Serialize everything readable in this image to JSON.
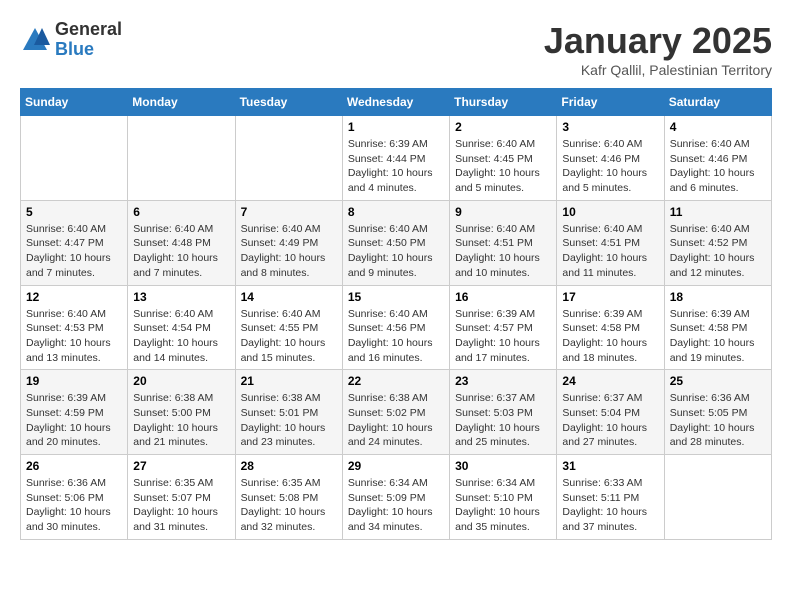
{
  "header": {
    "logo_general": "General",
    "logo_blue": "Blue",
    "month_title": "January 2025",
    "location": "Kafr Qallil, Palestinian Territory"
  },
  "days_of_week": [
    "Sunday",
    "Monday",
    "Tuesday",
    "Wednesday",
    "Thursday",
    "Friday",
    "Saturday"
  ],
  "weeks": [
    [
      {
        "day": "",
        "info": ""
      },
      {
        "day": "",
        "info": ""
      },
      {
        "day": "",
        "info": ""
      },
      {
        "day": "1",
        "info": "Sunrise: 6:39 AM\nSunset: 4:44 PM\nDaylight: 10 hours\nand 4 minutes."
      },
      {
        "day": "2",
        "info": "Sunrise: 6:40 AM\nSunset: 4:45 PM\nDaylight: 10 hours\nand 5 minutes."
      },
      {
        "day": "3",
        "info": "Sunrise: 6:40 AM\nSunset: 4:46 PM\nDaylight: 10 hours\nand 5 minutes."
      },
      {
        "day": "4",
        "info": "Sunrise: 6:40 AM\nSunset: 4:46 PM\nDaylight: 10 hours\nand 6 minutes."
      }
    ],
    [
      {
        "day": "5",
        "info": "Sunrise: 6:40 AM\nSunset: 4:47 PM\nDaylight: 10 hours\nand 7 minutes."
      },
      {
        "day": "6",
        "info": "Sunrise: 6:40 AM\nSunset: 4:48 PM\nDaylight: 10 hours\nand 7 minutes."
      },
      {
        "day": "7",
        "info": "Sunrise: 6:40 AM\nSunset: 4:49 PM\nDaylight: 10 hours\nand 8 minutes."
      },
      {
        "day": "8",
        "info": "Sunrise: 6:40 AM\nSunset: 4:50 PM\nDaylight: 10 hours\nand 9 minutes."
      },
      {
        "day": "9",
        "info": "Sunrise: 6:40 AM\nSunset: 4:51 PM\nDaylight: 10 hours\nand 10 minutes."
      },
      {
        "day": "10",
        "info": "Sunrise: 6:40 AM\nSunset: 4:51 PM\nDaylight: 10 hours\nand 11 minutes."
      },
      {
        "day": "11",
        "info": "Sunrise: 6:40 AM\nSunset: 4:52 PM\nDaylight: 10 hours\nand 12 minutes."
      }
    ],
    [
      {
        "day": "12",
        "info": "Sunrise: 6:40 AM\nSunset: 4:53 PM\nDaylight: 10 hours\nand 13 minutes."
      },
      {
        "day": "13",
        "info": "Sunrise: 6:40 AM\nSunset: 4:54 PM\nDaylight: 10 hours\nand 14 minutes."
      },
      {
        "day": "14",
        "info": "Sunrise: 6:40 AM\nSunset: 4:55 PM\nDaylight: 10 hours\nand 15 minutes."
      },
      {
        "day": "15",
        "info": "Sunrise: 6:40 AM\nSunset: 4:56 PM\nDaylight: 10 hours\nand 16 minutes."
      },
      {
        "day": "16",
        "info": "Sunrise: 6:39 AM\nSunset: 4:57 PM\nDaylight: 10 hours\nand 17 minutes."
      },
      {
        "day": "17",
        "info": "Sunrise: 6:39 AM\nSunset: 4:58 PM\nDaylight: 10 hours\nand 18 minutes."
      },
      {
        "day": "18",
        "info": "Sunrise: 6:39 AM\nSunset: 4:58 PM\nDaylight: 10 hours\nand 19 minutes."
      }
    ],
    [
      {
        "day": "19",
        "info": "Sunrise: 6:39 AM\nSunset: 4:59 PM\nDaylight: 10 hours\nand 20 minutes."
      },
      {
        "day": "20",
        "info": "Sunrise: 6:38 AM\nSunset: 5:00 PM\nDaylight: 10 hours\nand 21 minutes."
      },
      {
        "day": "21",
        "info": "Sunrise: 6:38 AM\nSunset: 5:01 PM\nDaylight: 10 hours\nand 23 minutes."
      },
      {
        "day": "22",
        "info": "Sunrise: 6:38 AM\nSunset: 5:02 PM\nDaylight: 10 hours\nand 24 minutes."
      },
      {
        "day": "23",
        "info": "Sunrise: 6:37 AM\nSunset: 5:03 PM\nDaylight: 10 hours\nand 25 minutes."
      },
      {
        "day": "24",
        "info": "Sunrise: 6:37 AM\nSunset: 5:04 PM\nDaylight: 10 hours\nand 27 minutes."
      },
      {
        "day": "25",
        "info": "Sunrise: 6:36 AM\nSunset: 5:05 PM\nDaylight: 10 hours\nand 28 minutes."
      }
    ],
    [
      {
        "day": "26",
        "info": "Sunrise: 6:36 AM\nSunset: 5:06 PM\nDaylight: 10 hours\nand 30 minutes."
      },
      {
        "day": "27",
        "info": "Sunrise: 6:35 AM\nSunset: 5:07 PM\nDaylight: 10 hours\nand 31 minutes."
      },
      {
        "day": "28",
        "info": "Sunrise: 6:35 AM\nSunset: 5:08 PM\nDaylight: 10 hours\nand 32 minutes."
      },
      {
        "day": "29",
        "info": "Sunrise: 6:34 AM\nSunset: 5:09 PM\nDaylight: 10 hours\nand 34 minutes."
      },
      {
        "day": "30",
        "info": "Sunrise: 6:34 AM\nSunset: 5:10 PM\nDaylight: 10 hours\nand 35 minutes."
      },
      {
        "day": "31",
        "info": "Sunrise: 6:33 AM\nSunset: 5:11 PM\nDaylight: 10 hours\nand 37 minutes."
      },
      {
        "day": "",
        "info": ""
      }
    ]
  ]
}
